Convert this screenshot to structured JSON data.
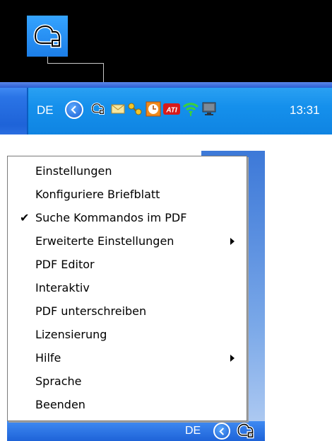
{
  "taskbar": {
    "language": "DE",
    "clock": "13:31",
    "tray_icons": [
      "chevron-left-icon",
      "pdf-printer-icon",
      "mail-icon",
      "keys-icon",
      "clock-app-icon",
      "ati-icon",
      "wireless-icon",
      "network-monitor-icon"
    ],
    "ati_label": "ATI"
  },
  "context_menu": {
    "items": [
      {
        "label": "Einstellungen",
        "checked": false,
        "submenu": false
      },
      {
        "label": "Konfiguriere Briefblatt",
        "checked": false,
        "submenu": false
      },
      {
        "label": "Suche Kommandos im PDF",
        "checked": true,
        "submenu": false
      },
      {
        "label": "Erweiterte Einstellungen",
        "checked": false,
        "submenu": true
      },
      {
        "label": "PDF Editor",
        "checked": false,
        "submenu": false
      },
      {
        "label": "Interaktiv",
        "checked": false,
        "submenu": false
      },
      {
        "label": "PDF unterschreiben",
        "checked": false,
        "submenu": false
      },
      {
        "label": "Lizensierung",
        "checked": false,
        "submenu": false
      },
      {
        "label": "Hilfe",
        "checked": false,
        "submenu": true
      },
      {
        "label": "Sprache",
        "checked": false,
        "submenu": false
      },
      {
        "label": "Beenden",
        "checked": false,
        "submenu": false
      }
    ],
    "check_glyph": "✔"
  },
  "bottom_taskbar": {
    "language": "DE"
  },
  "colors": {
    "taskbar_blue": "#1e63d8",
    "tray_blue": "#1590ec",
    "menu_border": "#7a7a7a"
  }
}
